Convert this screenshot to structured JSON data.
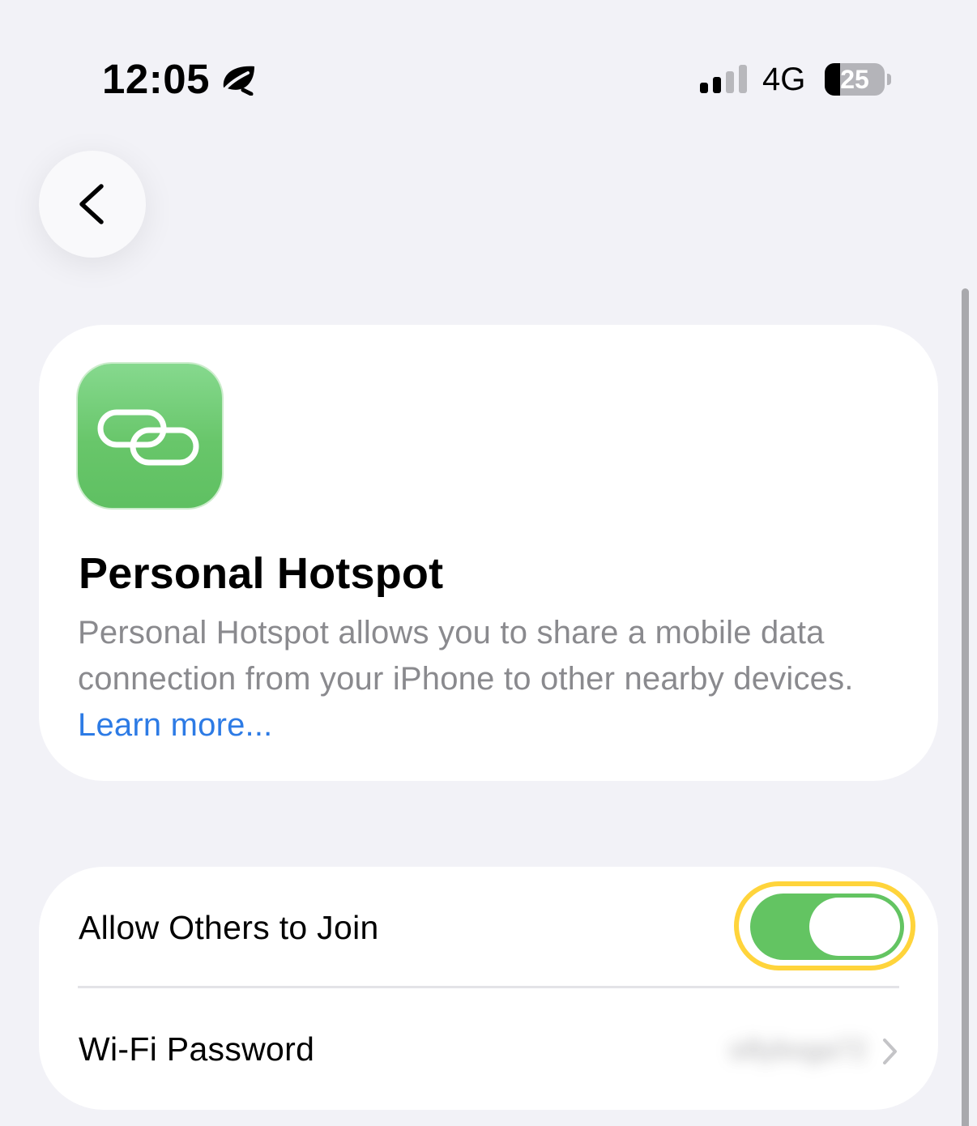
{
  "status_bar": {
    "time": "12:05",
    "focus_icon": "leaf-focus-icon",
    "network": "4G",
    "battery_percent": 25,
    "battery_label": "25"
  },
  "nav": {
    "back_icon": "chevron-left-icon"
  },
  "info_card": {
    "icon": "link-icon",
    "icon_color": "#65c466",
    "title": "Personal Hotspot",
    "description": "Personal Hotspot allows you to share a mobile data connection from your iPhone to other nearby devices.",
    "learn_more": "Learn more..."
  },
  "settings": {
    "allow_others": {
      "label": "Allow Others to Join",
      "on": true,
      "toggle_color": "#63c462",
      "highlight_color": "#ffd43b"
    },
    "wifi_password": {
      "label": "Wi-Fi Password",
      "value": "sillyboga72",
      "value_blurred": true,
      "chevron_icon": "chevron-right-icon"
    }
  },
  "colors": {
    "background": "#f2f2f7",
    "link": "#2d7be5",
    "secondary_text": "#8a8a8e"
  }
}
